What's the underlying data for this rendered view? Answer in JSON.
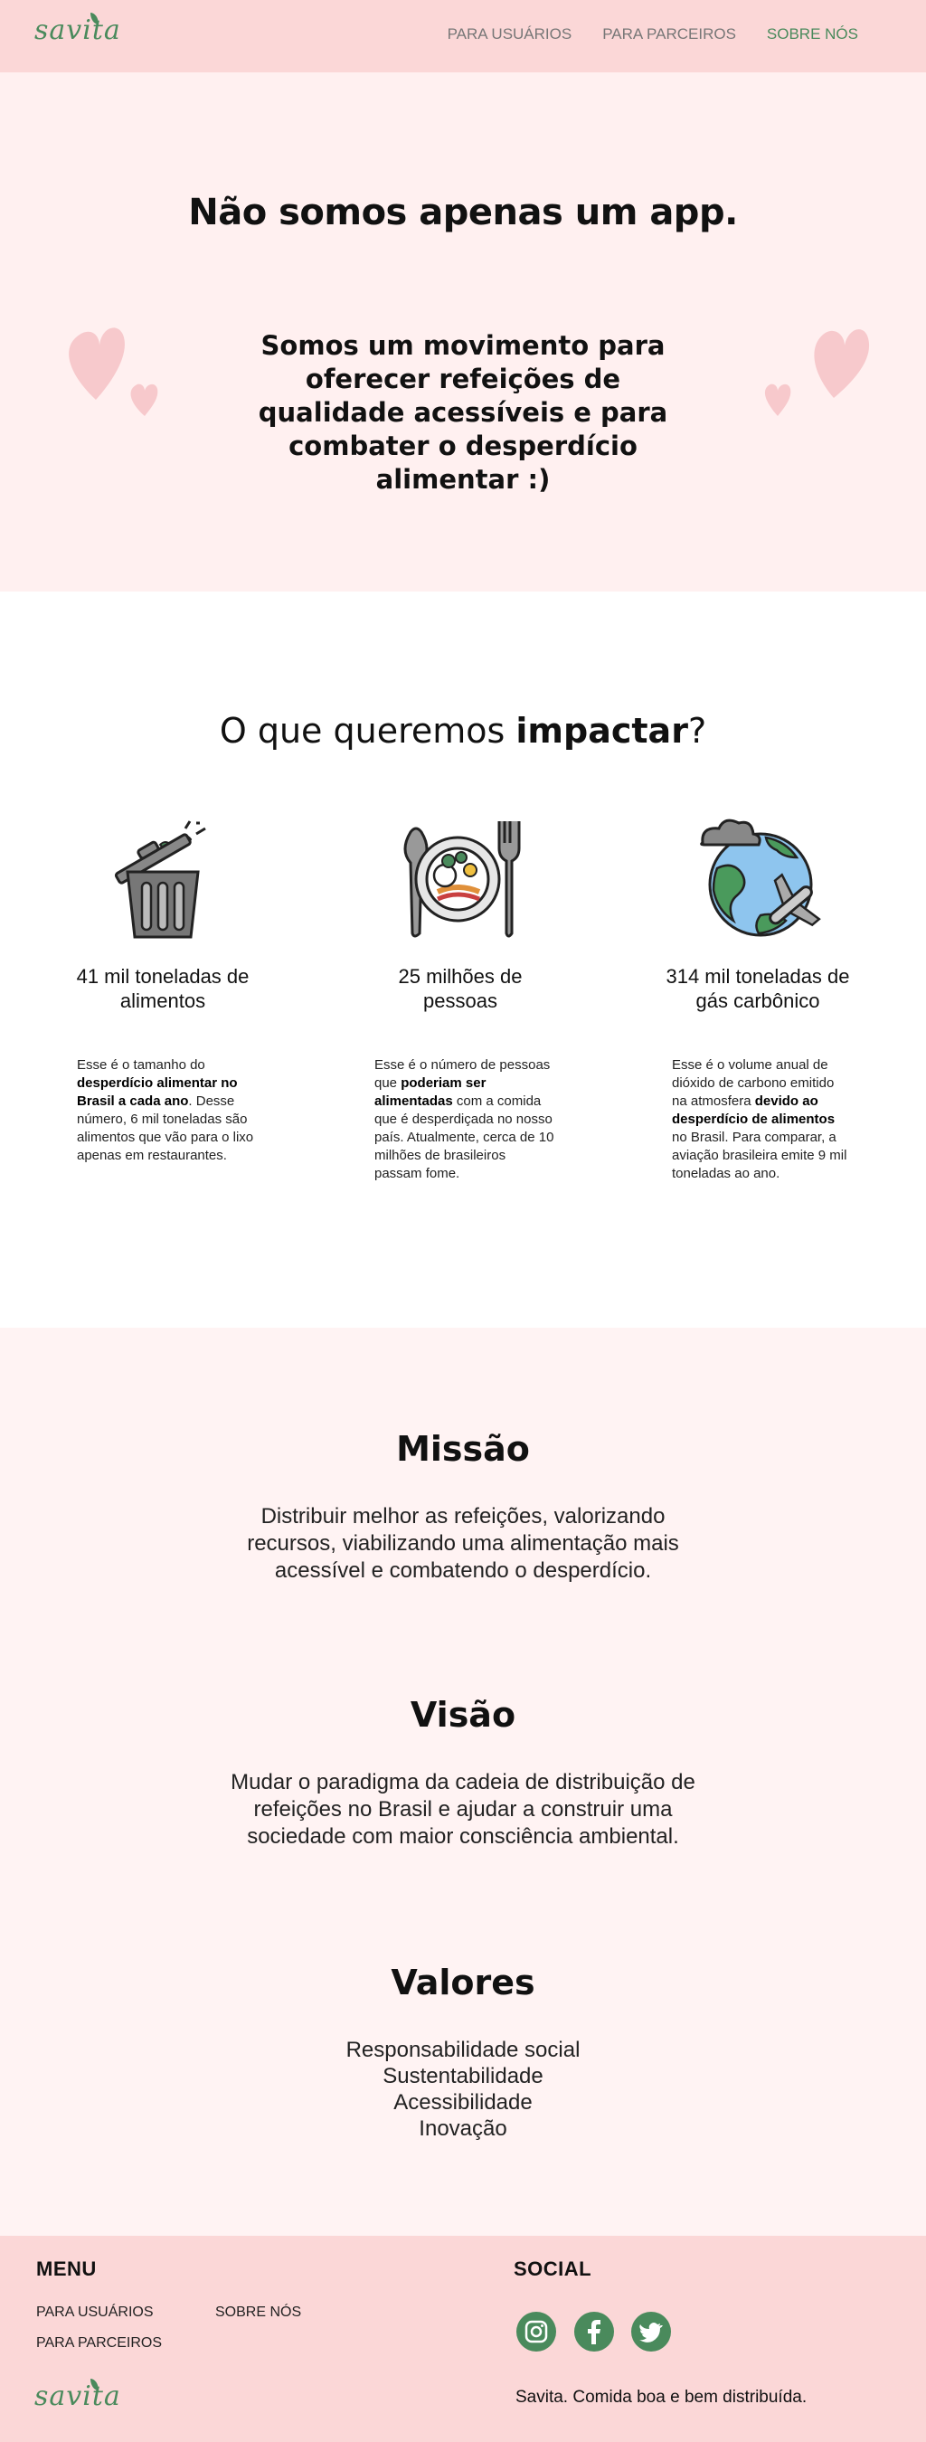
{
  "brand": {
    "logo_text": "savita"
  },
  "nav": {
    "links": [
      "PARA USUÁRIOS",
      "PARA PARCEIROS",
      "SOBRE NÓS"
    ]
  },
  "hero": {
    "title": "Não somos apenas um app.",
    "text_pre": "Somos um ",
    "text_bold": "movimento",
    "text_post": " para oferecer refeições de qualidade acessíveis e para combater o desperdício alimentar :)"
  },
  "impact": {
    "title_pre": "O que queremos ",
    "title_bold": "impactar",
    "title_post": "?",
    "items": [
      {
        "icon": "trash-can-icon",
        "stat": "41 mil toneladas de alimentos",
        "p1": "Esse é o tamanho do ",
        "b1": "desperdício alimentar no Brasil a cada ano",
        "p2": ". Desse número, 6 mil toneladas são alimentos que vão para o lixo apenas em restaurantes.",
        "b2": "",
        "p3": ""
      },
      {
        "icon": "plate-cutlery-icon",
        "stat": "25 milhões de pessoas",
        "p1": "Esse é o número de pessoas que ",
        "b1": "poderiam ser alimentadas",
        "p2": " com a comida que é desperdiçada no nosso país. Atualmente, cerca de 10 milhões de brasileiros passam fome.",
        "b2": "",
        "p3": ""
      },
      {
        "icon": "globe-airplane-icon",
        "stat": "314 mil toneladas de gás carbônico",
        "p1": "Esse é o volume anual de dióxido de carbono emitido na atmosfera ",
        "b1": "devido ao desperdício de alimentos",
        "p2": " no Brasil. Para comparar, a aviação brasileira emite 9 mil toneladas ao ano.",
        "b2": "",
        "p3": ""
      }
    ]
  },
  "mission": {
    "missao_title": "Missão",
    "missao_text": "Distribuir melhor as refeições, valorizando recursos, viabilizando uma alimentação mais acessível e combatendo o desperdício.",
    "visao_title": "Visão",
    "visao_text": "Mudar o paradigma da cadeia de distribuição de refeições no Brasil e ajudar a construir uma sociedade com maior consciência ambiental.",
    "valores_title": "Valores",
    "valores": [
      "Responsabilidade social",
      "Sustentabilidade",
      "Acessibilidade",
      "Inovação"
    ]
  },
  "footer": {
    "menu_title": "MENU",
    "menu_links": [
      "PARA USUÁRIOS",
      "SOBRE NÓS",
      "PARA PARCEIROS"
    ],
    "social_title": "SOCIAL",
    "social_icons": [
      "instagram-icon",
      "facebook-icon",
      "twitter-icon"
    ],
    "tagline": "Savita. Comida boa e bem distribuída."
  },
  "colors": {
    "brand_green": "#4a8a5c",
    "nav_pink": "#fbd7d7",
    "hero_pink": "#fff0f0",
    "section_pink": "#fff3f3"
  }
}
